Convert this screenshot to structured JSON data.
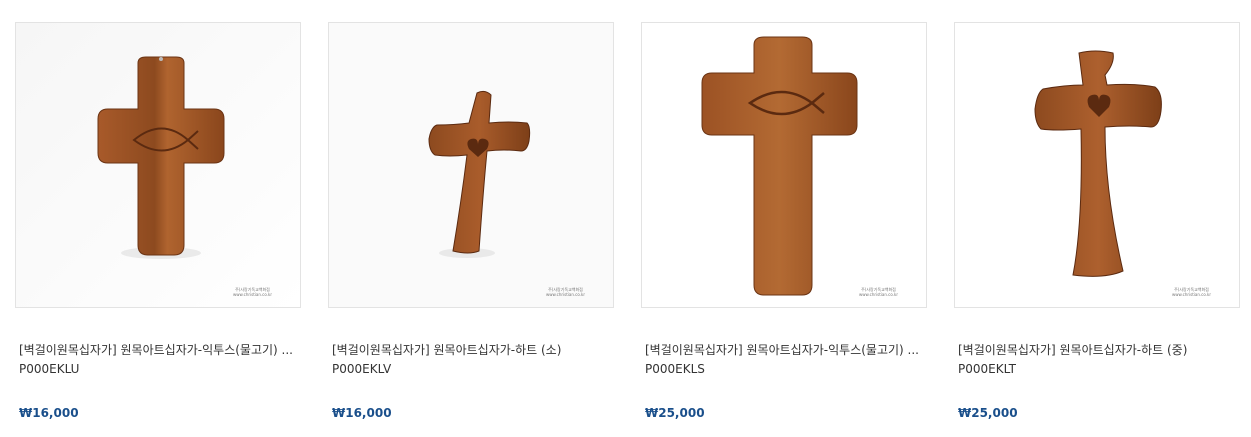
{
  "products": [
    {
      "title": "[벽걸이원목십자가] 원목아트십자가-익투스(물고기) ...",
      "code": "P000EKLU",
      "price": "₩16,000",
      "watermark": [
        "주)사랑기독교백화점",
        "www.christian.co.kr"
      ]
    },
    {
      "title": "[벽걸이원목십자가] 원목아트십자가-하트 (소)",
      "code": "P000EKLV",
      "price": "₩16,000",
      "watermark": [
        "주)사랑기독교백화점",
        "www.christian.co.kr"
      ]
    },
    {
      "title": "[벽걸이원목십자가] 원목아트십자가-익투스(물고기) ...",
      "code": "P000EKLS",
      "price": "₩25,000",
      "watermark": [
        "주)사랑기독교백화점",
        "www.christian.co.kr"
      ]
    },
    {
      "title": "[벽걸이원목십자가] 원목아트십자가-하트 (중)",
      "code": "P000EKLT",
      "price": "₩25,000",
      "watermark": [
        "주)사랑기독교백화점",
        "www.christian.co.kr"
      ]
    }
  ],
  "colors": {
    "price": "#1a4f8b",
    "wood": "#9a4f22",
    "wood_dark": "#6b3414"
  }
}
